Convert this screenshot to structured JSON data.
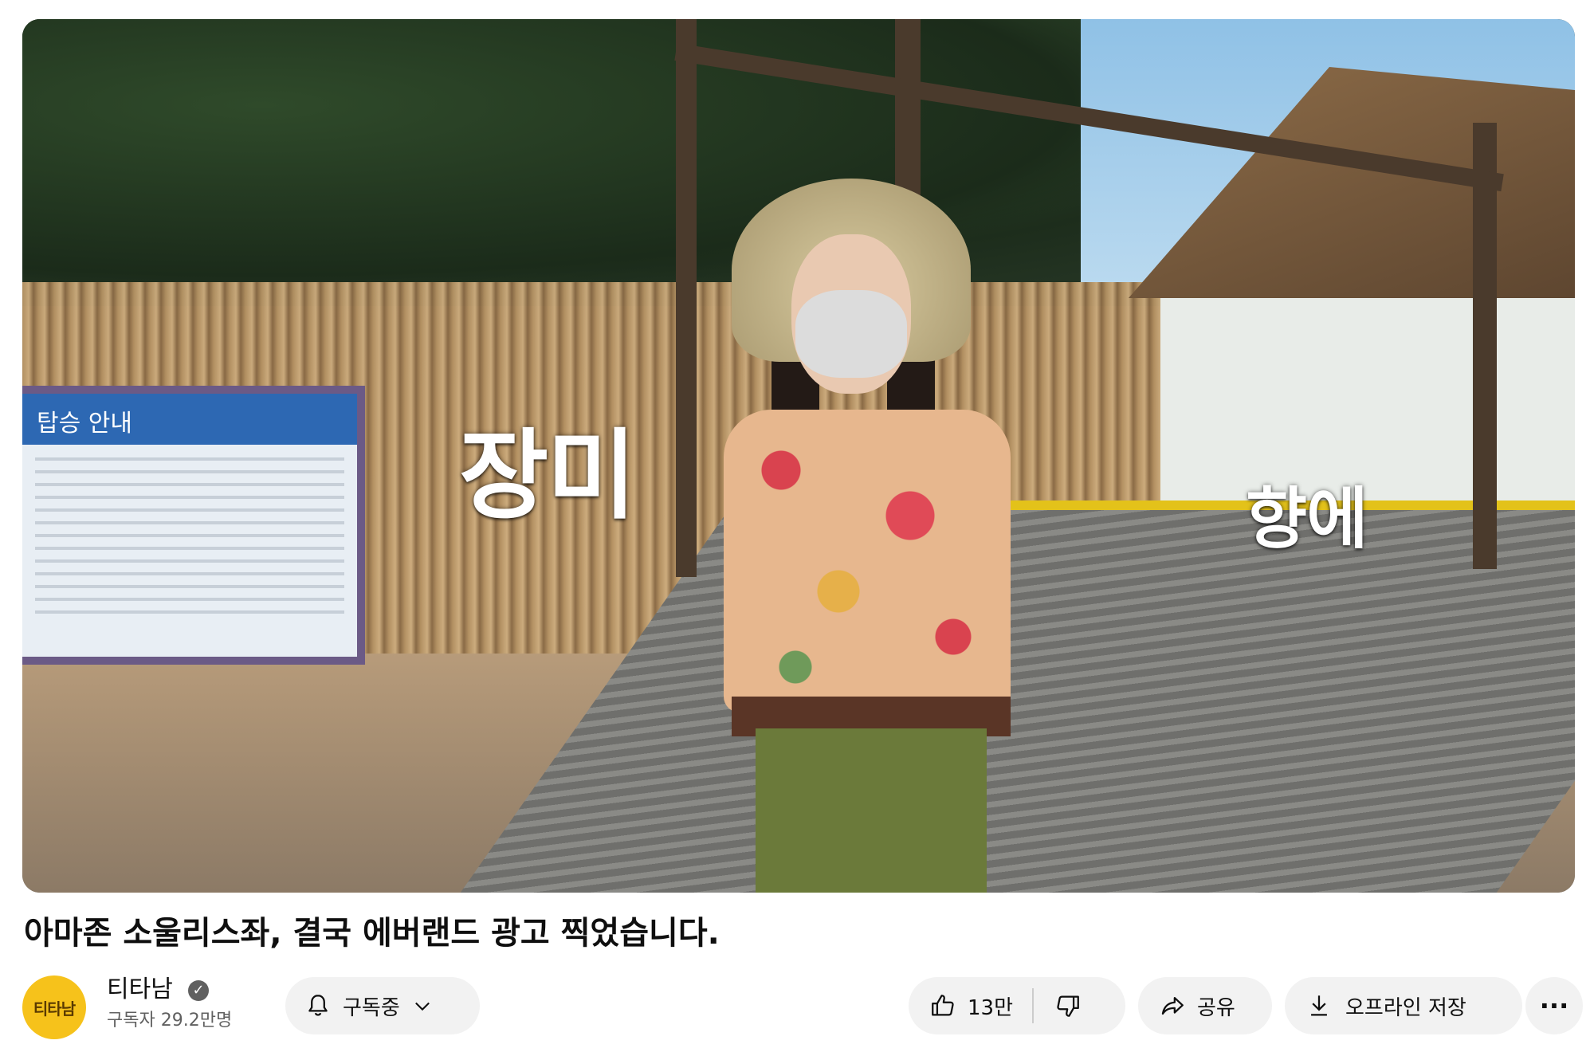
{
  "video": {
    "caption_1": "장미",
    "caption_2": "향에",
    "sign_heading": "탑승 안내"
  },
  "title": "아마존 소울리스좌, 결국 에버랜드 광고 찍었습니다.",
  "channel": {
    "name": "티타남",
    "avatar_text": "티타남",
    "verified_icon": "check-circle-icon",
    "subscribers": "구독자 29.2만명"
  },
  "actions": {
    "subscribe_label": "구독중",
    "like_count": "13만",
    "share_label": "공유",
    "download_label": "오프라인 저장",
    "more_label": "···"
  }
}
